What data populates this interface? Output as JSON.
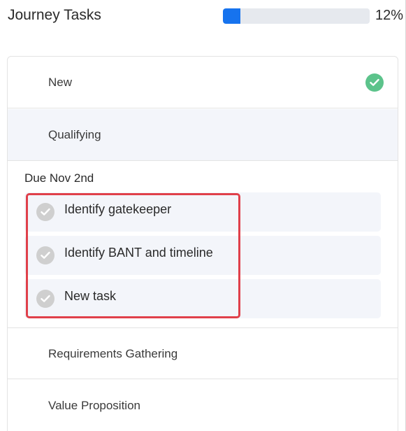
{
  "header": {
    "title": "Journey Tasks",
    "progress_label": "12%",
    "progress_value": 0.12,
    "progress_color": "#1673ee"
  },
  "stages": [
    {
      "label": "New",
      "completed": true,
      "check_color": "#5cc38b"
    },
    {
      "label": "Qualifying",
      "active": true
    },
    {
      "label": "Requirements Gathering"
    },
    {
      "label": "Value Proposition"
    }
  ],
  "qualifying": {
    "due_label": "Due Nov 2nd",
    "tasks": [
      {
        "label": "Identify gatekeeper",
        "icon": "check-circle-icon"
      },
      {
        "label": "Identify BANT and timeline",
        "icon": "check-circle-icon"
      },
      {
        "label": "New task",
        "icon": "check-circle-icon"
      }
    ]
  },
  "highlight_color": "#e0404a"
}
